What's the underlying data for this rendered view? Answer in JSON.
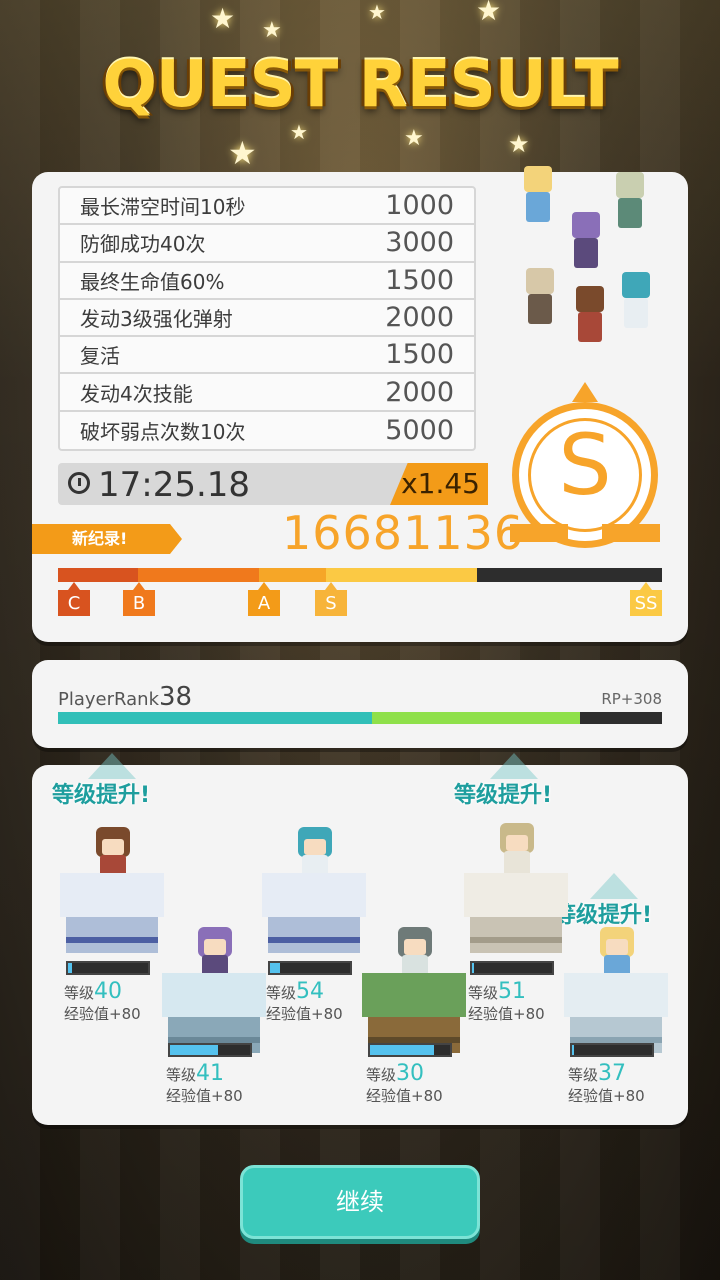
{
  "title": "QUEST RESULT",
  "missions": [
    {
      "label": "最长滞空时间10秒",
      "score": "1000"
    },
    {
      "label": "防御成功40次",
      "score": "3000"
    },
    {
      "label": "最终生命值60%",
      "score": "1500"
    },
    {
      "label": "发动3级强化弹射",
      "score": "2000"
    },
    {
      "label": "复活",
      "score": "1500"
    },
    {
      "label": "发动4次技能",
      "score": "2000"
    },
    {
      "label": "破坏弱点次数10次",
      "score": "5000"
    }
  ],
  "timer": "17:25.18",
  "multiplier": "x1.45",
  "new_record_label": "新纪录!",
  "total_score": "16681136",
  "grade": "S",
  "grade_marks": [
    "C",
    "B",
    "A",
    "S",
    "SS"
  ],
  "grade_progress": {
    "C_to_B": 0.133,
    "B_to_A": 0.2,
    "A_to_S": 0.11,
    "S_to_SS": 0.25,
    "reached": 0.705
  },
  "colors": {
    "accent": "#f7a42a",
    "teal": "#3ccabb",
    "xp": "#55c2ee",
    "levelup": "#1e9e9e"
  },
  "player_rank": {
    "label": "PlayerRank",
    "value": "38",
    "rp": "RP+308",
    "base_fill": 0.52,
    "gain_fill": 0.345
  },
  "party": [
    {
      "name_icon": "brown-hat-hero-sprite",
      "level_label": "等级",
      "level": "40",
      "exp": "经验值+80",
      "xp_fill": 0.05,
      "level_up": true
    },
    {
      "name_icon": "purple-hair-sprite",
      "level_label": "等级",
      "level": "41",
      "exp": "经验值+80",
      "xp_fill": 0.6,
      "level_up": false
    },
    {
      "name_icon": "teal-hair-nurse-sprite",
      "level_label": "等级",
      "level": "54",
      "exp": "经验值+80",
      "xp_fill": 0.12,
      "level_up": false
    },
    {
      "name_icon": "grey-hair-sprite",
      "level_label": "等级",
      "level": "30",
      "exp": "经验值+80",
      "xp_fill": 0.8,
      "level_up": false
    },
    {
      "name_icon": "lancer-sprite",
      "level_label": "等级",
      "level": "51",
      "exp": "经验值+80",
      "xp_fill": 0.02,
      "level_up": true
    },
    {
      "name_icon": "blonde-archer-sprite",
      "level_label": "等级",
      "level": "37",
      "exp": "经验值+80",
      "xp_fill": 0.02,
      "level_up": true
    }
  ],
  "level_up_label": "等级提升!",
  "continue_label": "继续"
}
